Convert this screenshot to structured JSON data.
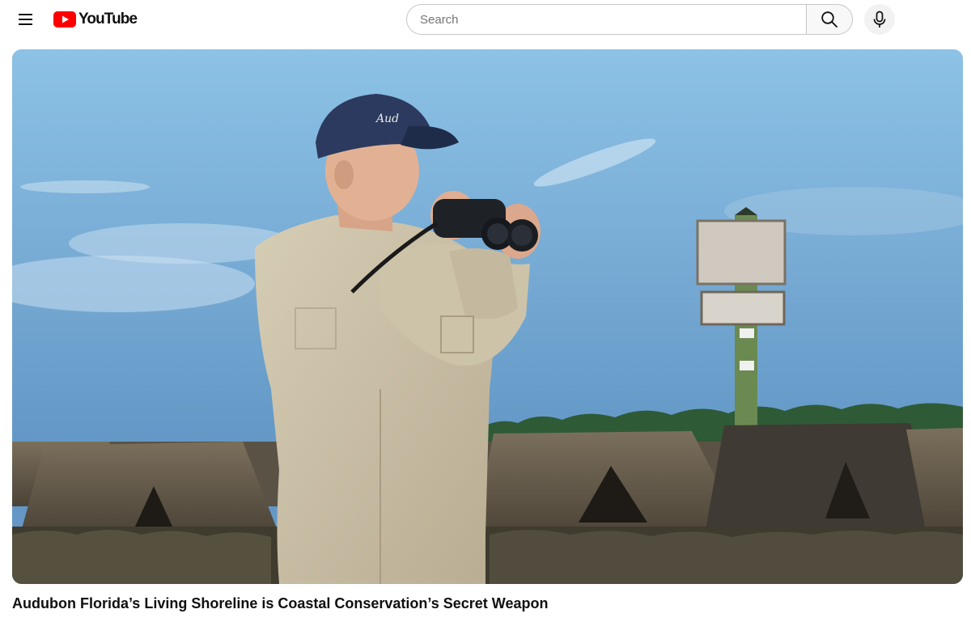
{
  "header": {
    "logo_text": "YouTube",
    "search_placeholder": "Search",
    "search_value": "",
    "icons": {
      "menu": "hamburger-menu-icon",
      "logo": "youtube-play-icon",
      "search": "search-icon",
      "mic": "microphone-icon"
    }
  },
  "video": {
    "title": "Audubon Florida’s Living Shoreline is Coastal Conservation’s Secret Weapon",
    "cap_logo_text": "Aud"
  },
  "colors": {
    "brand_red": "#ff0000",
    "text_primary": "#0f0f0f",
    "border": "#c6c6c6",
    "search_button_bg": "#f8f8f8"
  }
}
